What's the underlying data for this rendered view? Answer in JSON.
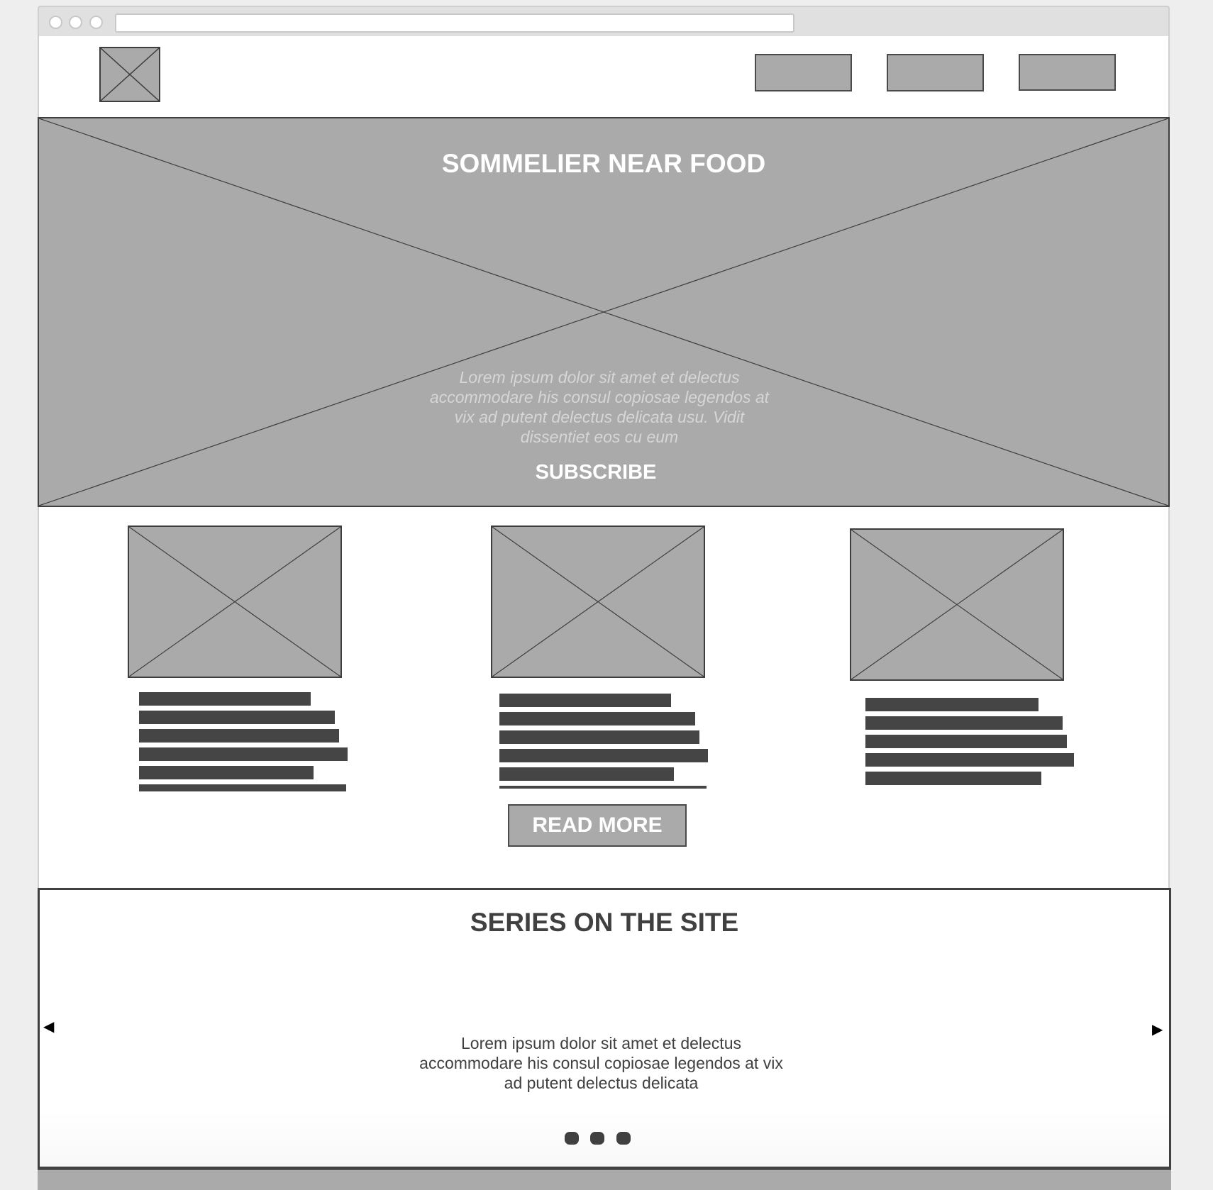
{
  "hero": {
    "title": "SOMMELIER NEAR FOOD",
    "description": "Lorem ipsum dolor sit amet et delectus accommodare his consul copiosae legendos at vix ad putent delectus delicata usu. Vidit dissentiet eos cu eum",
    "cta_label": "SUBSCRIBE"
  },
  "cards": {
    "read_more_label": "READ MORE"
  },
  "series": {
    "title": "SERIES ON THE SITE",
    "description": "Lorem ipsum dolor sit amet et delectus accommodare his consul copiosae legendos at vix ad putent delectus delicata",
    "prev_arrow": "◀",
    "next_arrow": "▶",
    "slide_count": 3
  },
  "icons": {
    "logo": "image-placeholder-icon",
    "carousel_prev": "triangle-left-icon",
    "carousel_next": "triangle-right-icon"
  },
  "colors": {
    "placeholder_fill": "#aaaaaa",
    "text_dark": "#404040",
    "text_light": "#ffffff"
  }
}
